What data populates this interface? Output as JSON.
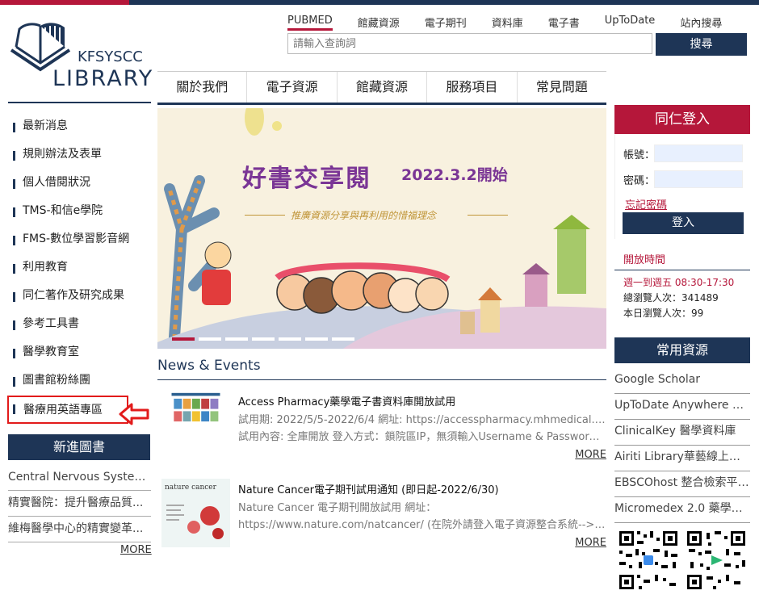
{
  "logo": {
    "line1": "KFSYSCC",
    "line2": "LIBRARY"
  },
  "top_links": [
    "PUBMED",
    "館藏資源",
    "電子期刊",
    "資料庫",
    "電子書",
    "UpToDate",
    "站內搜尋"
  ],
  "search": {
    "placeholder": "請輸入查詢詞",
    "button": "搜尋"
  },
  "main_nav": [
    "關於我們",
    "電子資源",
    "館藏資源",
    "服務項目",
    "常見問題"
  ],
  "left_nav": [
    "最新消息",
    "規則辦法及表單",
    "個人借閱狀況",
    "TMS-和信e學院",
    "FMS-數位學習影音網",
    "利用教育",
    "同仁著作及研究成果",
    "參考工具書",
    "醫學教育室",
    "圖書館粉絲團",
    "醫療用英語專區"
  ],
  "new_books": {
    "title": "新進圖書",
    "items": [
      "Central Nervous System ...",
      "精實醫院：提升醫療品質...",
      "維梅醫學中心的精實變革..."
    ],
    "more": "MORE"
  },
  "banner": {
    "title": "好書交享閱",
    "date": "2022.3.2開始",
    "subtitle": "推廣資源分享與再利用的惜福理念"
  },
  "news": {
    "title": "News & Events",
    "items": [
      {
        "title": "Access Pharmacy藥學電子書資料庫開放試用",
        "lines": [
          "試用期: 2022/5/5-2022/6/4 網址: https://accesspharmacy.mhmedical.com/",
          "試用內容: 全庫開放 登入方式：鎖院區IP，無須輸入Username & Password..."
        ],
        "more": "MORE"
      },
      {
        "title": "Nature Cancer電子期刊試用通知 (即日起-2022/6/30)",
        "lines": [
          "Nature Cancer 電子期刊開放試用 網址：",
          "https://www.nature.com/natcancer/ (在院外請登入電子資源整合系統-->電..."
        ],
        "more": "MORE",
        "thumb_text": "nature cancer"
      }
    ]
  },
  "login": {
    "title": "同仁登入",
    "account_label": "帳號：",
    "password_label": "密碼：",
    "forget": "忘記密碼",
    "button": "登入"
  },
  "hours": {
    "title": "開放時間",
    "schedule": "週一到週五 08:30-17:30",
    "total_visits": "總瀏覽人次：341489",
    "today_visits": "本日瀏覽人次：99"
  },
  "resources": {
    "title": "常用資源",
    "items": [
      "Google Scholar",
      "UpToDate Anywhere 臨...",
      "ClinicalKey 醫學資料庫",
      "Airiti Library華藝線上圖...",
      "EBSCOhost 整合檢索平台...",
      "Micromedex 2.0 藥學資..."
    ]
  },
  "colors": {
    "navy": "#1e3556",
    "crimson": "#b5173a",
    "banner_purple": "#7a3595",
    "highlight_red": "#e21b1b"
  }
}
